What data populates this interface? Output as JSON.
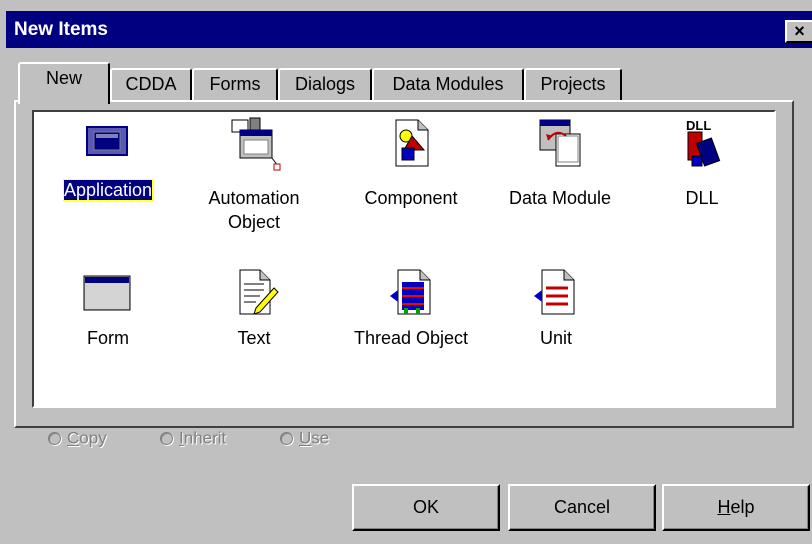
{
  "window": {
    "title": "New Items",
    "close_label": "×"
  },
  "tabs": [
    {
      "label": "New",
      "active": true
    },
    {
      "label": "CDDA",
      "active": false
    },
    {
      "label": "Forms",
      "active": false
    },
    {
      "label": "Dialogs",
      "active": false
    },
    {
      "label": "Data Modules",
      "active": false
    },
    {
      "label": "Projects",
      "active": false
    }
  ],
  "items": [
    {
      "label": "Application",
      "icon": "application-icon",
      "selected": true
    },
    {
      "label_line1": "Automation",
      "label_line2": "Object",
      "icon": "automation-object-icon"
    },
    {
      "label": "Component",
      "icon": "component-icon"
    },
    {
      "label": "Data Module",
      "icon": "data-module-icon"
    },
    {
      "label": "DLL",
      "icon": "dll-icon",
      "icon_text": "DLL"
    },
    {
      "label": "Form",
      "icon": "form-icon"
    },
    {
      "label": "Text",
      "icon": "text-icon"
    },
    {
      "label": "Thread Object",
      "icon": "thread-object-icon"
    },
    {
      "label": "Unit",
      "icon": "unit-icon"
    }
  ],
  "options": {
    "copy": {
      "prefix": "",
      "accel": "C",
      "rest": "opy"
    },
    "inherit": {
      "prefix": "",
      "accel": "I",
      "rest": "nherit"
    },
    "use": {
      "prefix": "",
      "accel": "U",
      "rest": "se"
    }
  },
  "buttons": {
    "ok": "OK",
    "cancel": "Cancel",
    "help_accel": "H",
    "help_rest": "elp"
  },
  "colors": {
    "titlebar": "#000080",
    "face": "#c0c0c0",
    "selection": "#000080"
  }
}
